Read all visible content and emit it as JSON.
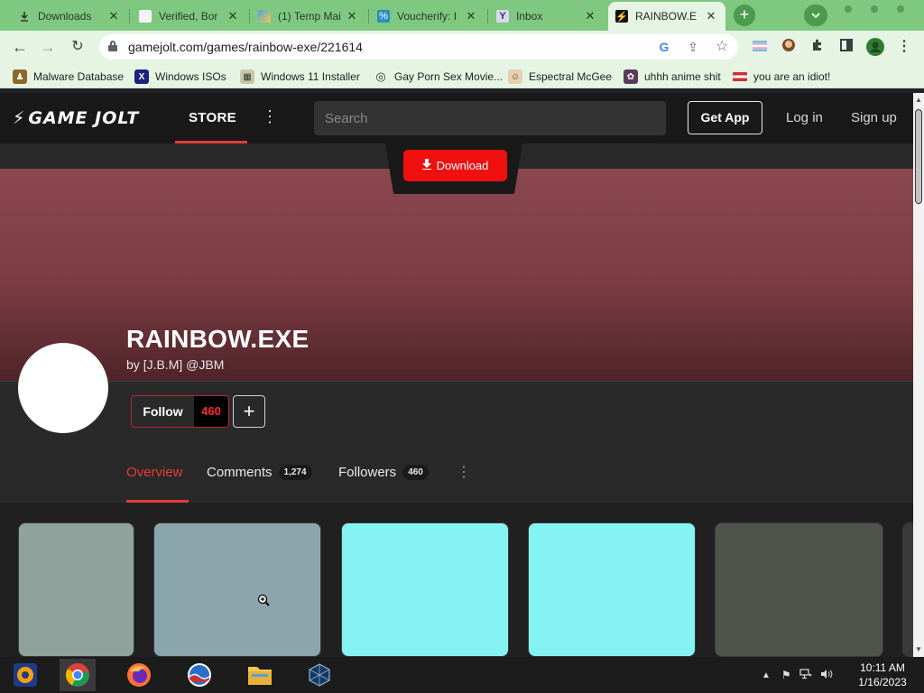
{
  "browser": {
    "tabs": [
      {
        "title": "Downloads",
        "icon": "download-icon",
        "active": false
      },
      {
        "title": "Verified, Bor",
        "icon": "page-icon",
        "active": false
      },
      {
        "title": "(1) Temp Mai",
        "icon": "tempmail-icon",
        "active": false
      },
      {
        "title": "Voucherify: I",
        "icon": "voucherify-icon",
        "active": false
      },
      {
        "title": "Inbox",
        "icon": "yahoo-icon",
        "active": false
      },
      {
        "title": "RAINBOW.E",
        "icon": "gamejolt-icon",
        "active": true
      }
    ],
    "url": "gamejolt.com/games/rainbow-exe/221614",
    "bookmarks": [
      {
        "label": "Malware Database",
        "icon": "person-icon"
      },
      {
        "label": "Windows ISOs",
        "icon": "x-logo-icon"
      },
      {
        "label": "Windows 11 Installer",
        "icon": "installer-icon"
      },
      {
        "label": "Gay Porn Sex Movie...",
        "icon": "fingerprint-icon"
      },
      {
        "label": "Espectral McGee",
        "icon": "face-icon"
      },
      {
        "label": "uhhh anime shit",
        "icon": "anime-icon"
      },
      {
        "label": "you are an idiot!",
        "icon": "flag-icon"
      }
    ]
  },
  "site": {
    "logo": "GAME JOLT",
    "nav_store": "STORE",
    "search_placeholder": "Search",
    "get_app": "Get App",
    "login": "Log in",
    "signup": "Sign up"
  },
  "game": {
    "download_label": "Download",
    "title": "RAINBOW.EXE",
    "by_prefix": "by",
    "developer": "[J.B.M]",
    "handle": "@JBM",
    "follow_label": "Follow",
    "follow_count": "460",
    "plus_label": "+"
  },
  "page_tabs": [
    {
      "label": "Overview",
      "count": ""
    },
    {
      "label": "Comments",
      "count": "1,274"
    },
    {
      "label": "Followers",
      "count": "460"
    }
  ],
  "thumbnail_colors": [
    "#8fa39c",
    "#8aa5ac",
    "#86f3f3",
    "#86f3f3",
    "#4e544b"
  ],
  "taskbar": {
    "apps": [
      "windows-media-icon",
      "chrome-icon",
      "firefox-icon",
      "obama-icon",
      "file-explorer-icon",
      "virtualbox-icon"
    ],
    "time": "10:11 AM",
    "date": "1/16/2023"
  },
  "colors": {
    "chrome_frame": "#7ec87f",
    "toolbar": "#e6f4e4",
    "gj_accent": "#e33b3b",
    "download_red": "#f01010",
    "banner": "#8b474f"
  }
}
